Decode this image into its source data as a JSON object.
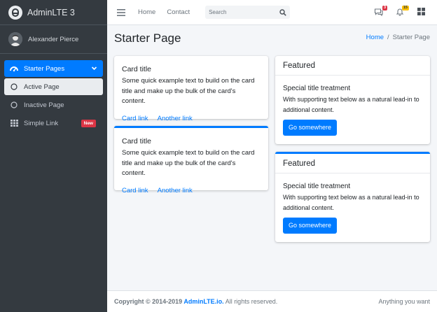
{
  "brand": {
    "name": "AdminLTE 3"
  },
  "user": {
    "name": "Alexander Pierce"
  },
  "sidebar": {
    "items": [
      {
        "label": "Starter Pages",
        "state": "active",
        "icon": "dashboard-icon"
      },
      {
        "label": "Active Page",
        "state": "sub-active",
        "icon": "circle-icon"
      },
      {
        "label": "Inactive Page",
        "state": "normal",
        "icon": "circle-icon"
      },
      {
        "label": "Simple Link",
        "state": "normal",
        "icon": "grid-icon",
        "badge": "New"
      }
    ]
  },
  "navbar": {
    "links": [
      "Home",
      "Contact"
    ],
    "search_placeholder": "Search",
    "messages_count": "3",
    "notifications_count": "15"
  },
  "header": {
    "title": "Starter Page",
    "breadcrumb": [
      "Home",
      "Starter Page"
    ]
  },
  "cards": [
    {
      "title": "Card title",
      "text": "Some quick example text to build on the card title and make up the bulk of the card's content.",
      "links": [
        "Card link",
        "Another link"
      ]
    },
    {
      "title": "Card title",
      "text": "Some quick example text to build on the card title and make up the bulk of the card's content.",
      "links": [
        "Card link",
        "Another link"
      ]
    }
  ],
  "featured": [
    {
      "header": "Featured",
      "title": "Special title treatment",
      "text": "With supporting text below as a natural lead-in to additional content.",
      "button": "Go somewhere"
    },
    {
      "header": "Featured",
      "title": "Special title treatment",
      "text": "With supporting text below as a natural lead-in to additional content.",
      "button": "Go somewhere"
    }
  ],
  "footer": {
    "copyright": "Copyright © 2014-2019",
    "link": "AdminLTE.io.",
    "rights": "All rights reserved.",
    "right_text": "Anything you want"
  },
  "colors": {
    "primary": "#007bff",
    "sidebar_bg": "#343a40",
    "danger": "#dc3545",
    "warning": "#ffc107"
  }
}
